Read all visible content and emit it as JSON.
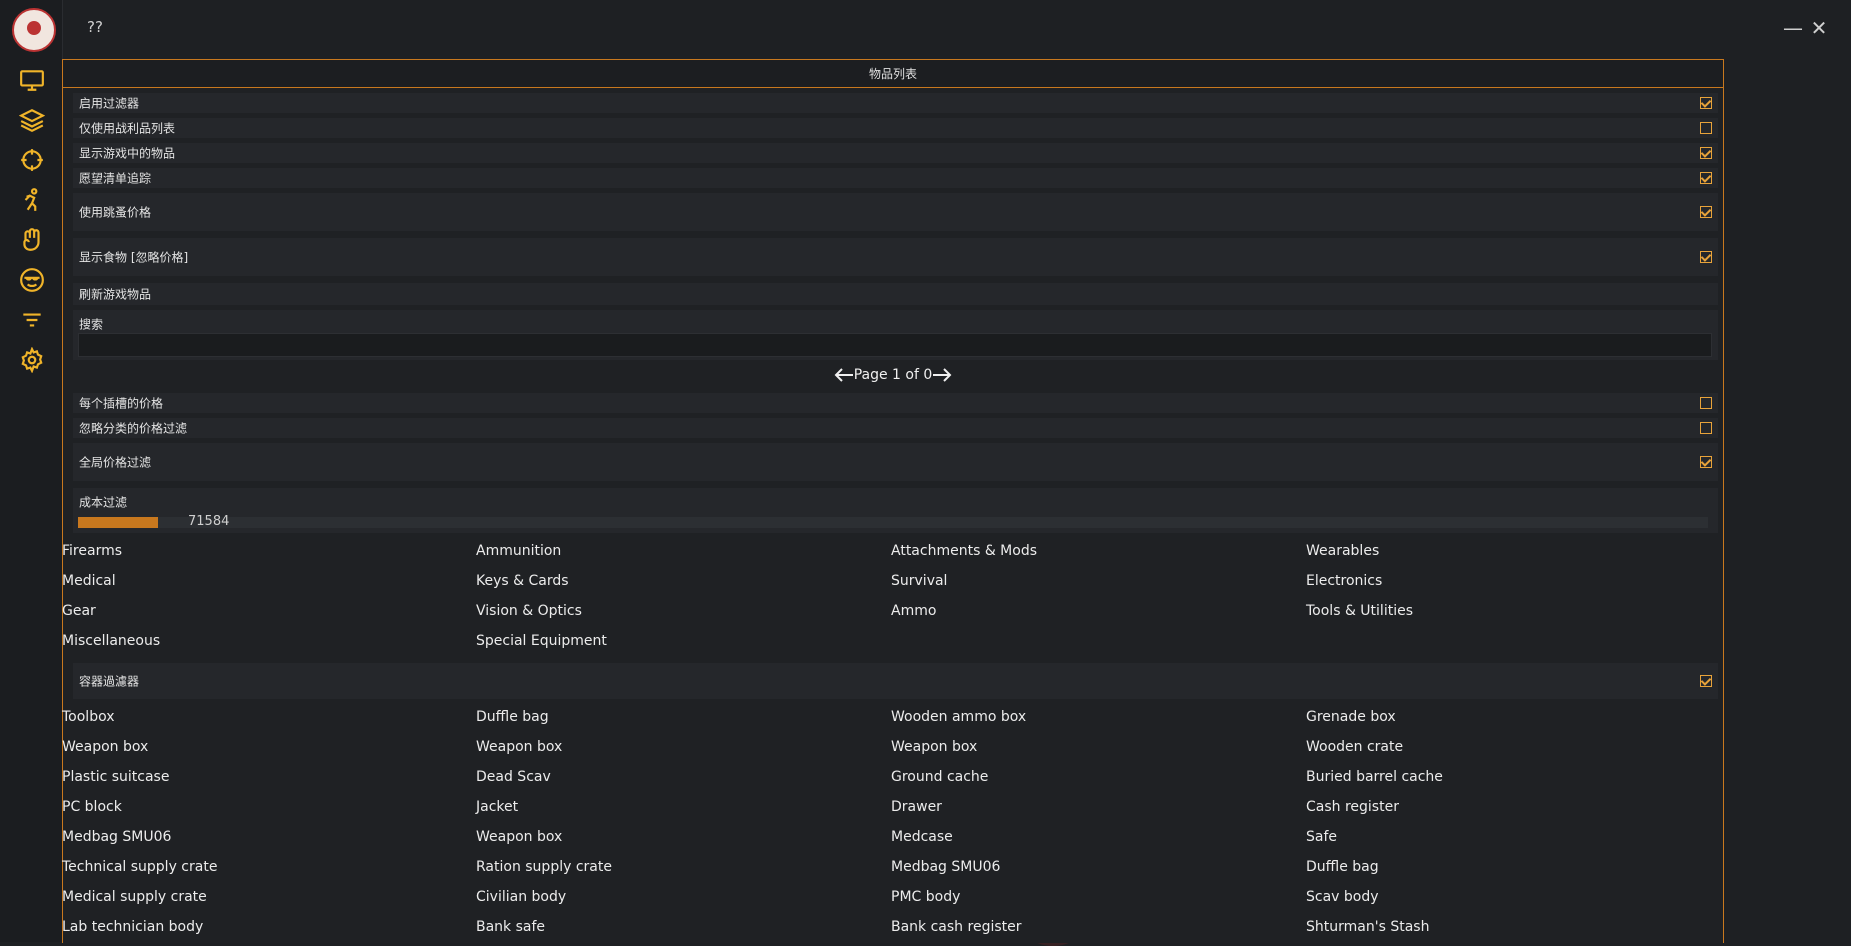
{
  "app": {
    "title": "??"
  },
  "window": {
    "minimize": "—",
    "close": "✕"
  },
  "sidebar": {
    "icons": [
      "monitor-icon",
      "layers-icon",
      "crosshair-icon",
      "running-person-icon",
      "hand-icon",
      "smiley-sunglasses-icon",
      "filter-icon",
      "gear-icon"
    ]
  },
  "panel": {
    "title": "物品列表",
    "toggles": [
      {
        "label": "启用过滤器",
        "checked": true
      },
      {
        "label": "仅使用战利品列表",
        "checked": false
      },
      {
        "label": "显示游戏中的物品",
        "checked": true
      },
      {
        "label": "愿望清单追踪",
        "checked": true
      },
      {
        "label": "使用跳蚤价格",
        "checked": true
      },
      {
        "label": "显示食物 [忽略价格]",
        "checked": true
      }
    ],
    "refresh_label": "刷新游戏物品",
    "search": {
      "label": "搜索",
      "value": ""
    },
    "pager": {
      "text": "Page 1 of 0"
    },
    "toggles2": [
      {
        "label": "每个插槽的价格",
        "checked": false
      },
      {
        "label": "忽略分类的价格过滤",
        "checked": false
      },
      {
        "label": "全局价格过滤",
        "checked": true
      }
    ],
    "cost": {
      "label": "成本过滤",
      "value": "71584",
      "fill_fraction": 0.049
    },
    "categories": [
      "Firearms",
      "Ammunition",
      "Attachments & Mods",
      "Wearables",
      "Medical",
      "Keys & Cards",
      "Survival",
      "Electronics",
      "Gear",
      "Vision & Optics",
      "Ammo",
      "Tools & Utilities",
      "Miscellaneous",
      "Special Equipment"
    ],
    "container_filter": {
      "label": "容器過濾器",
      "checked": true
    },
    "containers": [
      "Toolbox",
      "Duffle bag",
      "Wooden ammo box",
      "Grenade box",
      "Weapon box",
      "Weapon box",
      "Weapon box",
      "Wooden crate",
      "Plastic suitcase",
      "Dead Scav",
      "Ground cache",
      "Buried barrel cache",
      "PC block",
      "Jacket",
      "Drawer",
      "Cash register",
      "Medbag SMU06",
      "Weapon box",
      "Medcase",
      "Safe",
      "Technical supply crate",
      "Ration supply crate",
      "Medbag SMU06",
      "Duffle bag",
      "Medical supply crate",
      "Civilian body",
      "PMC body",
      "Scav body",
      "Lab technician body",
      "Bank safe",
      "Bank cash register",
      "Shturman's Stash"
    ]
  },
  "colors": {
    "accent": "#c8781e",
    "checkbox": "#e8a33a",
    "background": "#1e2023",
    "row": "#25272b",
    "icon": "#f0b429"
  }
}
